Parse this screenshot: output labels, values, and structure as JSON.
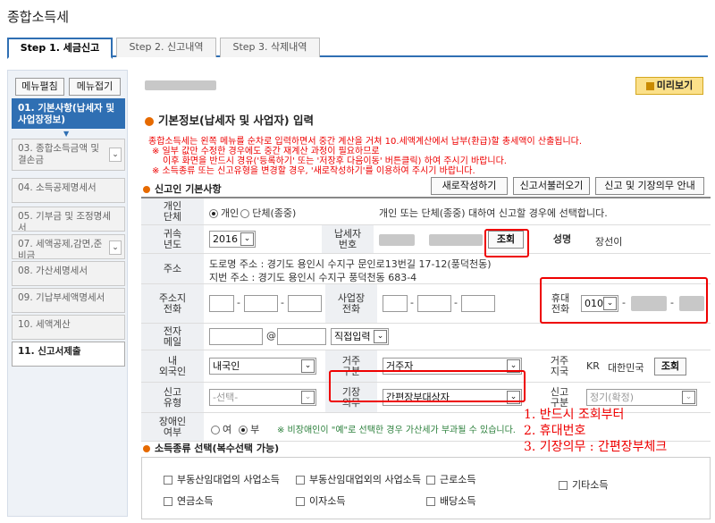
{
  "page_title": "종합소득세",
  "tabs": [
    {
      "label": "Step 1. 세금신고"
    },
    {
      "label": "Step 2. 신고내역"
    },
    {
      "label": "Step 3. 삭제내역"
    }
  ],
  "sidebar": {
    "edit_btn": "메뉴펼침",
    "collapse_btn": "메뉴접기",
    "items": [
      {
        "label": "01. 기본사항(납세자 및 사업장정보)"
      },
      {
        "label": "03. 종합소득금액 및 결손금"
      },
      {
        "label": "04. 소득공제명세서"
      },
      {
        "label": "05. 기부금 및 조정명세서"
      },
      {
        "label": "07. 세액공제,감면,준비금"
      },
      {
        "label": "08. 가산세명세서"
      },
      {
        "label": "09. 기납부세액명세서"
      },
      {
        "label": "10. 세액계산"
      },
      {
        "label": "11. 신고서제출"
      }
    ]
  },
  "preview_btn": "미리보기",
  "section_title": "기본정보(납세자 및 사업자) 입력",
  "notices": [
    "종합소득세는 왼쪽 메뉴를 순차로 입력하면서 중간 계산을 거쳐 10.세액계산에서 납부(환급)할 총세액이 산출됩니다.",
    "※ 일부 값만 수정한 경우에도 중간 재계산 과정이 필요하므로",
    "이후 화면을 반드시 경유('등록하기' 또는 '저장후 다음이동' 버튼클릭) 하여 주시기 바랍니다.",
    "※ 소득종류 또는 신고유형을 변경할 경우, '새로작성하기'를 이용하여 주시기 바랍니다."
  ],
  "basic_section": "신고인 기본사항",
  "buttons": {
    "new": "새로작성하기",
    "load": "신고서불러오기",
    "guide": "신고 및 기장의무 안내",
    "lookup": "조회",
    "lookup2": "조회"
  },
  "form": {
    "type_label": "개인\n단체",
    "type_opt1": "개인",
    "type_opt2": "단체(종중)",
    "type_help": "개인 또는 단체(종중) 대하여 신고할 경우에 선택합니다.",
    "year_label": "귀속\n년도",
    "year_value": "2016",
    "taxpayer_no_label": "납세자\n번호",
    "name_label": "성명",
    "name_value": "장선이",
    "addr_label": "주소",
    "road_addr": "도로명 주소 : 경기도 용인시 수지구 문인로13번길 17-12(풍덕천동)",
    "lot_addr": "지번 주소 : 경기도 용인시 수지구 풍덕천동 683-4",
    "home_phone_label": "주소지\n전화",
    "biz_phone_label": "사업장\n전화",
    "mobile_label": "휴대\n전화",
    "mobile_prefix": "010",
    "email_label": "전자\n메일",
    "email_at": "@",
    "email_select": "직접입력",
    "foreign_label": "내\n외국인",
    "foreign_value": "내국인",
    "residence_label": "거주\n구분",
    "residence_value": "거주자",
    "country_label": "거주\n지국",
    "country_code": "KR",
    "country_name": "대한민국",
    "filing_label": "신고\n유형",
    "filing_value": "-선택-",
    "bookkeeping_label": "기장\n의무",
    "bookkeeping_value": "간편장부대상자",
    "filing_class_label": "신고\n구분",
    "filing_class_value": "정기(확정)",
    "disabled_label": "장애인\n여부",
    "disabled_yes": "여",
    "disabled_no": "부",
    "disabled_help": "※ 비장애인이 \"예\"로 선택한 경우 가산세가 부과될 수 있습니다."
  },
  "annotations": [
    "1. 반드시 조회부터",
    "2. 휴대번호",
    "3. 기장의무 : 간편장부체크"
  ],
  "income_section": "소득종류 선택(복수선택 가능)",
  "income_types": [
    "부동산임대업의 사업소득",
    "부동산임대업외의 사업소득",
    "근로소득",
    "기타소득",
    "연금소득",
    "이자소득",
    "배당소득"
  ]
}
